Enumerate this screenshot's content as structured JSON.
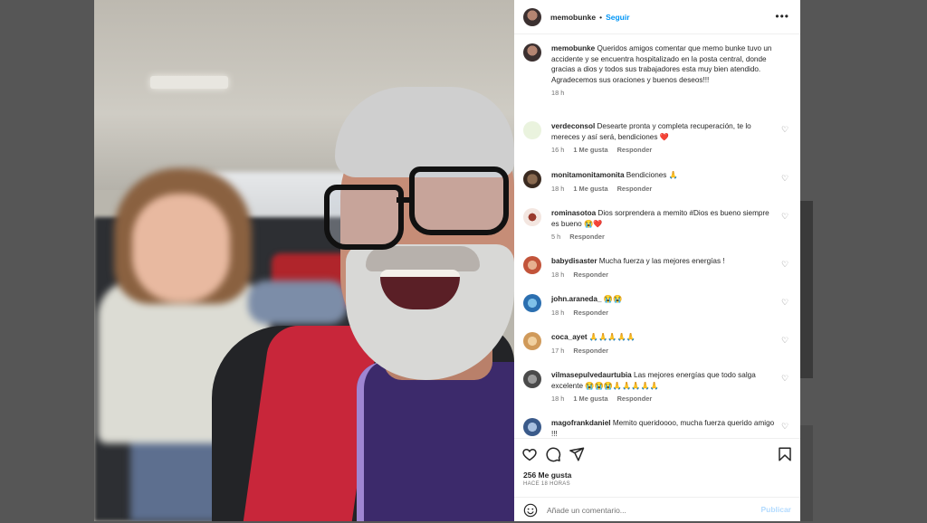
{
  "post": {
    "username": "memobunke",
    "dot": "•",
    "follow_label": "Seguir",
    "more_label": "•••",
    "caption_user": "memobunke",
    "caption_line1": "Queridos amigos comentar que memo bunke tuvo un accidente y se encuentra hospitalizado en la posta central, donde gracias a dios y todos sus trabajadores esta muy bien atendido.",
    "caption_line2": "Agradecemos sus oraciones y buenos deseos!!!",
    "caption_time": "18 h",
    "likes": "256 Me gusta",
    "when": "HACE 18 HORAS"
  },
  "comments": [
    {
      "user": "verdeconsol",
      "text": "Desearte pronta y completa recuperación, te lo mereces y así será, bendiciones ❤️",
      "time": "16 h",
      "likes": "1 Me gusta",
      "reply": "Responder",
      "avatar_color": "#7aa63a"
    },
    {
      "user": "monitamonitamonita",
      "text": "Bendiciones 🙏",
      "time": "18 h",
      "likes": "1 Me gusta",
      "reply": "Responder",
      "avatar_color": "#6b4d3a"
    },
    {
      "user": "rominasotoa",
      "text": "Dios sorprendera a memito #Dios es bueno siempre es bueno 😭❤️",
      "time": "5 h",
      "likes": "",
      "reply": "Responder",
      "avatar_color": "#9a3b2e"
    },
    {
      "user": "babydisaster",
      "text": "Mucha fuerza y las mejores energías !",
      "time": "18 h",
      "likes": "",
      "reply": "Responder",
      "avatar_color": "#c2543a"
    },
    {
      "user": "john.araneda_",
      "text": "😭😭",
      "time": "18 h",
      "likes": "",
      "reply": "Responder",
      "avatar_color": "#2b6fb0"
    },
    {
      "user": "coca_ayet",
      "text": "🙏🙏🙏🙏🙏",
      "time": "17 h",
      "likes": "",
      "reply": "Responder",
      "avatar_color": "#d09a5a"
    },
    {
      "user": "vilmasepulvedaurtubia",
      "text": "Las mejores energías que todo salga excelente 😭😭😭🙏🙏🙏🙏🙏",
      "time": "18 h",
      "likes": "1 Me gusta",
      "reply": "Responder",
      "avatar_color": "#4a4a4a"
    },
    {
      "user": "magofrankdaniel",
      "text": "Memito queridoooo, mucha fuerza querido amigo !!!",
      "time": "",
      "likes": "",
      "reply": "",
      "avatar_color": "#3a5a8a"
    }
  ],
  "composer": {
    "placeholder": "Añade un comentario...",
    "post_label": "Publicar"
  },
  "icons": {
    "like": "heart-icon",
    "comment": "comment-icon",
    "share": "share-icon",
    "save": "bookmark-icon",
    "emoji": "emoji-icon"
  }
}
